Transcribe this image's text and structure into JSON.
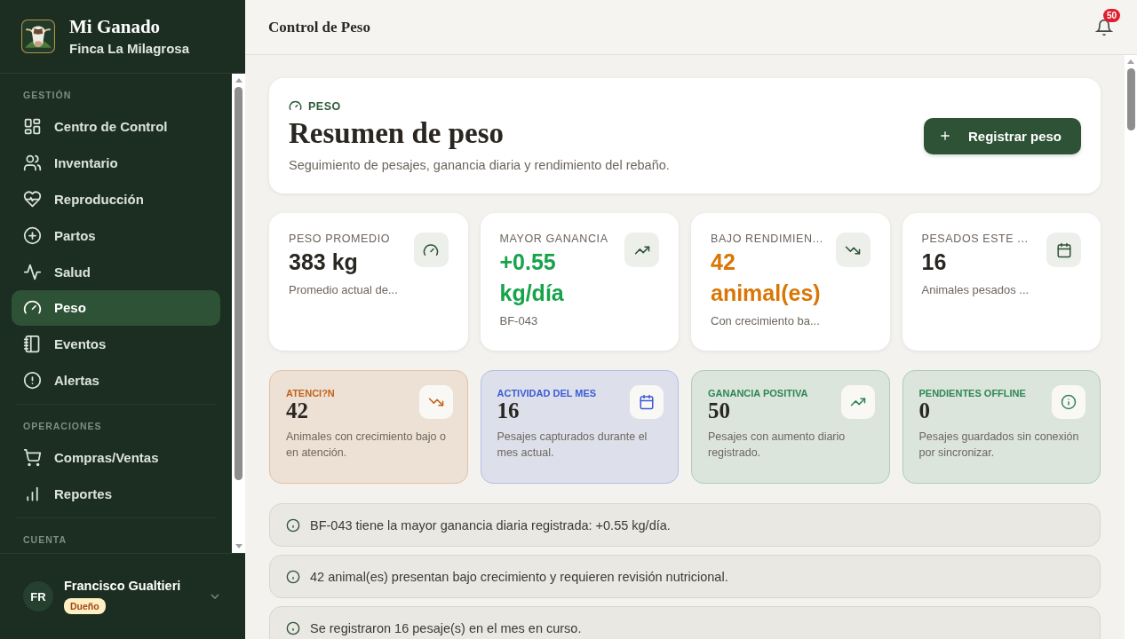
{
  "sidebar": {
    "brand": {
      "title": "Mi Ganado",
      "subtitle": "Finca La Milagrosa"
    },
    "sections": [
      {
        "label": "GESTIÓN",
        "items": [
          {
            "label": "Centro de Control",
            "selected": false
          },
          {
            "label": "Inventario",
            "selected": false
          },
          {
            "label": "Reproducción",
            "selected": false
          },
          {
            "label": "Partos",
            "selected": false
          },
          {
            "label": "Salud",
            "selected": false
          },
          {
            "label": "Peso",
            "selected": true
          },
          {
            "label": "Eventos",
            "selected": false
          },
          {
            "label": "Alertas",
            "selected": false
          }
        ]
      },
      {
        "label": "OPERACIONES",
        "items": [
          {
            "label": "Compras/Ventas",
            "selected": false
          },
          {
            "label": "Reportes",
            "selected": false
          }
        ]
      },
      {
        "label": "CUENTA"
      }
    ],
    "user": {
      "initials": "FR",
      "name": "Francisco Gualtieri",
      "role": "Dueño"
    }
  },
  "header": {
    "title": "Control de Peso",
    "notifications": "50"
  },
  "hero": {
    "eyebrow": "PESO",
    "title": "Resumen de peso",
    "subtitle": "Seguimiento de pesajes, ganancia diaria y rendimiento del rebaño.",
    "button": "Registrar peso"
  },
  "stats": [
    {
      "label": "PESO PROMEDIO",
      "value": "383 kg",
      "note": "Promedio actual de...",
      "color": "#2a2622"
    },
    {
      "label": "MAYOR GANANCIA",
      "value": "+0.55 kg/día",
      "note": "BF-043",
      "color": "#16a34a"
    },
    {
      "label": "BAJO RENDIMIEN...",
      "value": "42 animal(es)",
      "note": "Con crecimiento ba...",
      "color": "#d97706"
    },
    {
      "label": "PESADOS ESTE ...",
      "value": "16",
      "note": "Animales pesados ...",
      "color": "#2a2622"
    }
  ],
  "tiles": [
    {
      "label": "ATENCI?N",
      "value": "42",
      "note": "Animales con crecimiento bajo o en atención.",
      "color": "#c2621a"
    },
    {
      "label": "ACTIVIDAD DEL MES",
      "value": "16",
      "note": "Pesajes capturados durante el mes actual.",
      "color": "#3b5bd6"
    },
    {
      "label": "GANANCIA POSITIVA",
      "value": "50",
      "note": "Pesajes con aumento diario registrado.",
      "color": "#2f8657"
    },
    {
      "label": "PENDIENTES OFFLINE",
      "value": "0",
      "note": "Pesajes guardados sin conexión por sincronizar.",
      "color": "#2f8657"
    }
  ],
  "insights": [
    "BF-043 tiene la mayor ganancia diaria registrada: +0.55 kg/día.",
    "42 animal(es) presentan bajo crecimiento y requieren revisión nutricional.",
    "Se registraron 16 pesaje(s) en el mes en curso."
  ]
}
